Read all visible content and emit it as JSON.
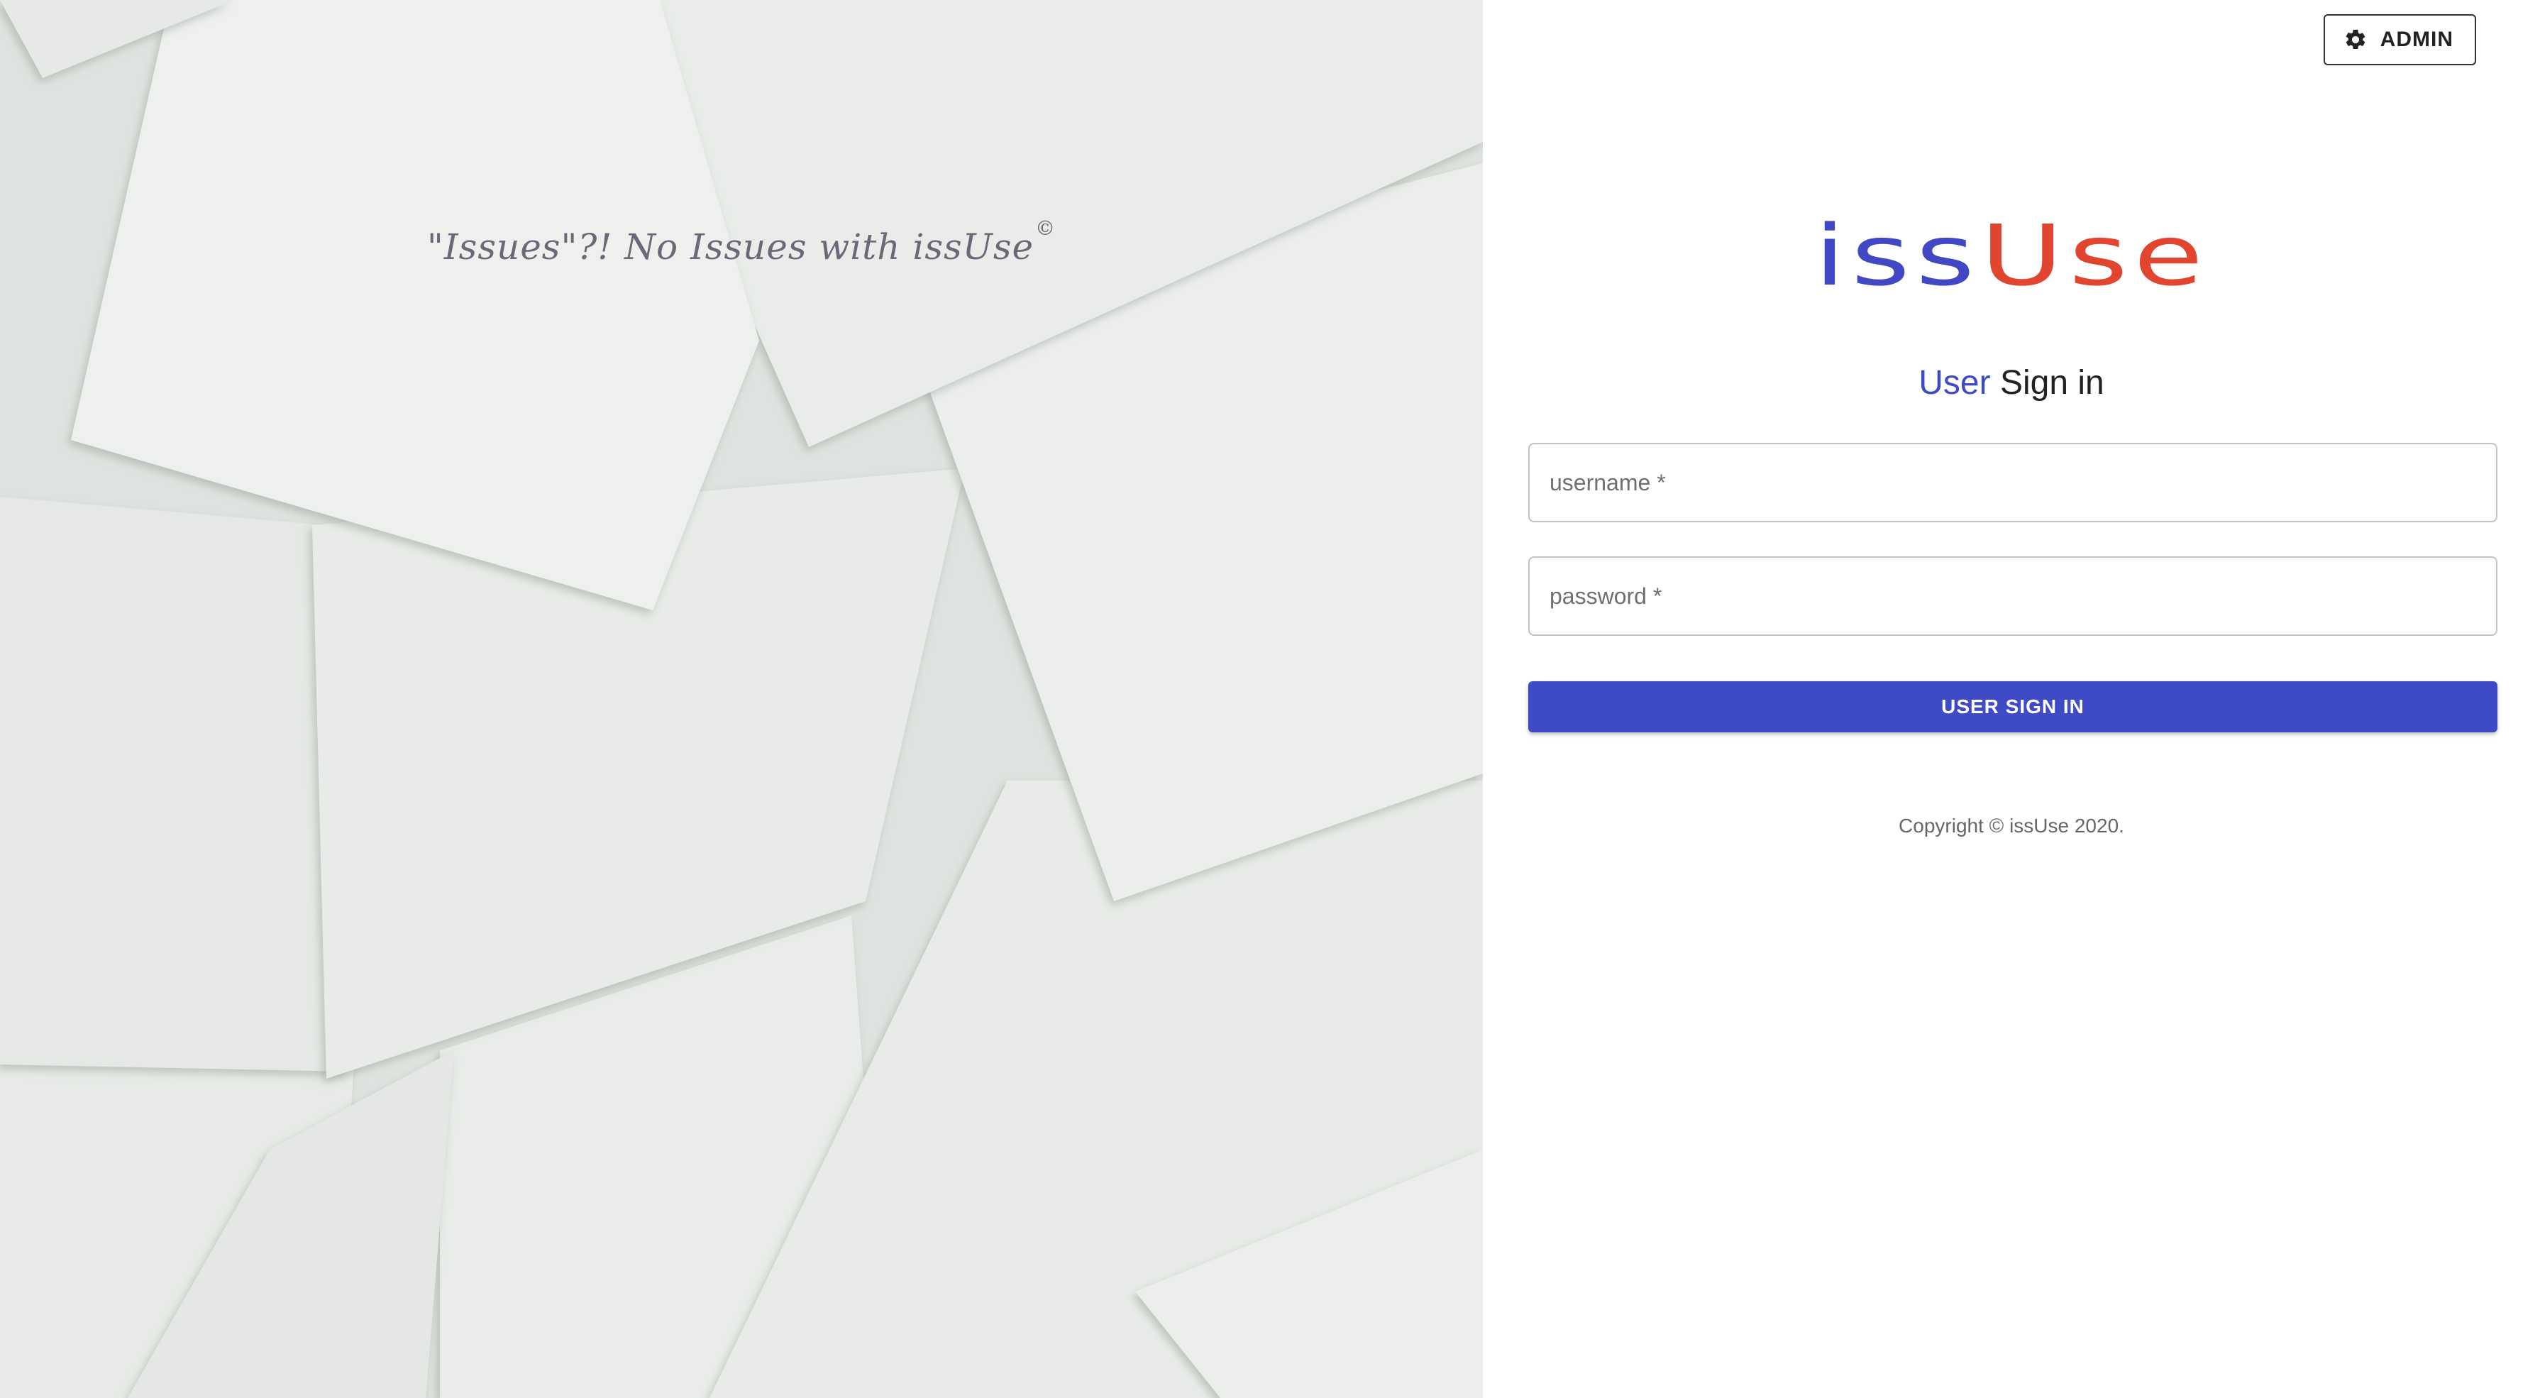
{
  "hero": {
    "tagline": "\"Issues\"?! No Issues with issUse",
    "tagline_mark": "©"
  },
  "header": {
    "admin_label": "ADMIN",
    "admin_icon": "gear-icon"
  },
  "logo": {
    "part1": "iss",
    "part2": "Use",
    "colors": {
      "part1": "#4248c4",
      "part2": "#e2452f"
    }
  },
  "signin": {
    "title_accent": "User",
    "title_rest": "Sign in",
    "username_placeholder": "username *",
    "username_value": "",
    "password_placeholder": "password *",
    "password_value": "",
    "submit_label": "USER SIGN IN"
  },
  "footer": {
    "copyright": "Copyright © issUse 2020."
  },
  "colors": {
    "accent": "#3f4ac7",
    "brand_red": "#e2452f"
  }
}
